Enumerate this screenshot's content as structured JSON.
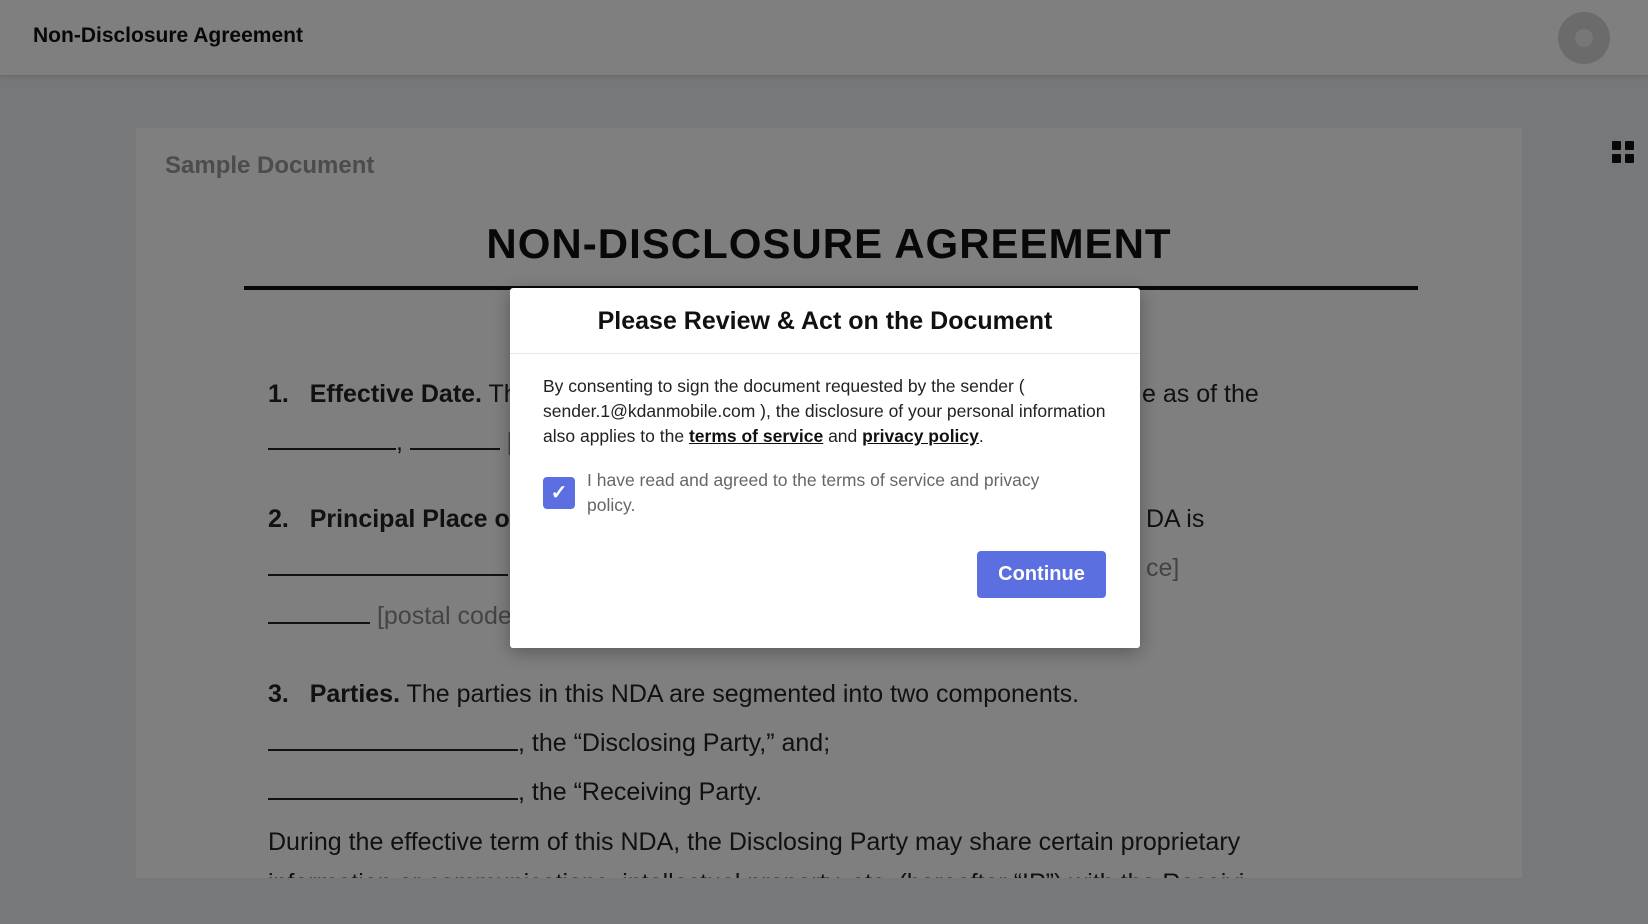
{
  "header": {
    "title": "Non-Disclosure Agreement",
    "avatar_icon": "user-avatar-icon",
    "apps_icon": "grid-icon"
  },
  "document": {
    "label": "Sample Document",
    "heading": "NON-DISCLOSURE AGREEMENT",
    "section1": {
      "num": "1.",
      "title": "Effective Date.",
      "text_start": "Th",
      "text_end": "e as of the"
    },
    "section2": {
      "num": "2.",
      "title": "Principal Place o",
      "text_end": "DA is",
      "line2_end": "ce]",
      "postal": "[postal code"
    },
    "section3": {
      "num": "3.",
      "title": "Parties.",
      "text": "The parties in this NDA are segmented into two components.",
      "disclosing": ", the “Disclosing Party,” and;",
      "receiving": ", the “Receiving Party."
    },
    "paragraph": "During the effective term of this NDA, the Disclosing Party may share certain proprietary",
    "paragraph_cut": "information or communications, intellectual property, etc. (hereafter “IP”) with the Receivi"
  },
  "modal": {
    "title": "Please Review & Act on the Document",
    "body_intro": "By consenting to sign the document requested by the sender ( sender.1@kdanmobile.com ), the disclosure of your personal information also applies to the",
    "terms_link": "terms of service",
    "and_text": "and",
    "privacy_link": "privacy policy",
    "period": ".",
    "consent_label": "I have read and agreed to the terms of service and privacy policy.",
    "consent_checked": true,
    "checkmark": "✓",
    "continue_label": "Continue"
  },
  "colors": {
    "accent": "#5b6fe0",
    "overlay": "rgba(0,0,0,0.5)"
  }
}
